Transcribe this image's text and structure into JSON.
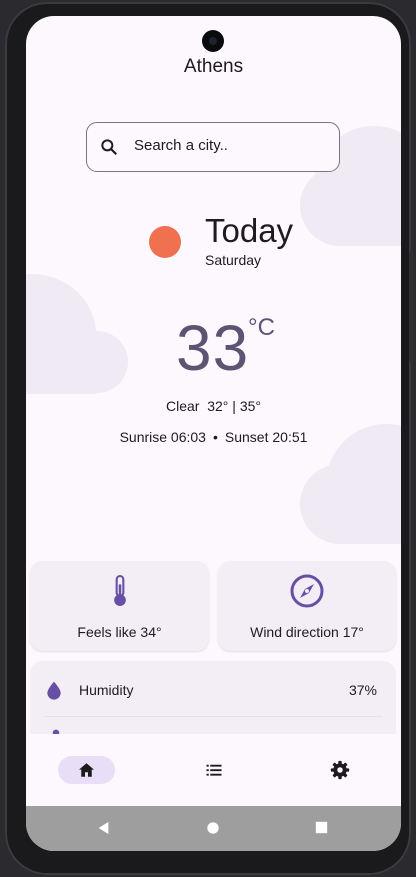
{
  "header": {
    "city": "Athens"
  },
  "search": {
    "placeholder": "Search a city..",
    "icon": "search-icon"
  },
  "current": {
    "title": "Today",
    "weekday": "Saturday",
    "icon": "sun-icon",
    "sun_color": "#ef7150",
    "temperature": "33",
    "unit": "°C",
    "condition": "Clear",
    "min_max": "32° | 35°",
    "sunrise": "Sunrise 06:03",
    "sunset": "Sunset 20:51",
    "separator": "•"
  },
  "cards": [
    {
      "label": "Feels like 34°",
      "icon": "thermometer-icon"
    },
    {
      "label": "Wind direction 17°",
      "icon": "compass-icon"
    }
  ],
  "details": [
    {
      "label": "Humidity",
      "value": "37%",
      "icon": "water-drop-icon"
    }
  ],
  "nav": [
    {
      "name": "home",
      "icon": "home-icon",
      "selected": true
    },
    {
      "name": "list",
      "icon": "list-icon",
      "selected": false
    },
    {
      "name": "settings",
      "icon": "settings-icon",
      "selected": false
    }
  ],
  "colors": {
    "accent": "#6750a4",
    "temp_text": "#5d5372",
    "background": "#fdf8fd",
    "card": "#f3eef6"
  }
}
